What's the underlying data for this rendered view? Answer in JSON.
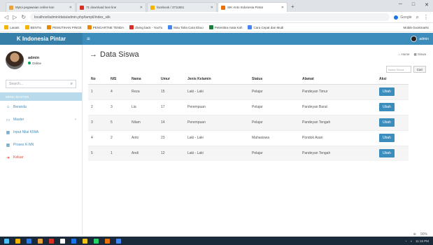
{
  "browser": {
    "tabs": [
      {
        "title": "Mytoi pegawaian online kan",
        "color": "#e8a33a",
        "active": false
      },
      {
        "title": "71 download love line",
        "color": "#d93025",
        "active": false
      },
      {
        "title": "facebook / 3711651",
        "color": "#f4b400",
        "active": false
      },
      {
        "title": "SIK Anto Indonesia Pintar",
        "color": "#e8710a",
        "active": true
      }
    ],
    "url": "localhost/admin/data/admin.php/tampil/index_siik",
    "search_engine": "Google",
    "bookmarks": [
      {
        "label": "Lanats",
        "color": "#f4b400"
      },
      {
        "label": "BENTIx",
        "color": "#f4b400"
      },
      {
        "label": "PEMUTIHAN PINGE",
        "color": "#ea8600"
      },
      {
        "label": "PENGARTNE TENDA",
        "color": "#ea8600"
      },
      {
        "label": "diving back - YouTu",
        "color": "#d93025"
      },
      {
        "label": "Mau Talra Cara Ebuo",
        "color": "#4285f4"
      },
      {
        "label": "Petentitra mata Kah",
        "color": "#188038"
      },
      {
        "label": "Cara Cepat dan Mudi",
        "color": "#4285f4"
      }
    ],
    "bookmarks_right": "Mobile bookmarks"
  },
  "header": {
    "brand": "K Indonesia Pintar",
    "user": "admin"
  },
  "sidebar": {
    "user_name": "admin",
    "user_status": "Online",
    "search_placeholder": "Search...",
    "menu_header": "MENU MASTER",
    "items": [
      {
        "label": "Beranda",
        "icon": "home-icon",
        "glyph": "⌂",
        "red": false,
        "chevron": false
      },
      {
        "label": "Master",
        "icon": "laptop-icon",
        "glyph": "▭",
        "red": false,
        "chevron": true
      },
      {
        "label": "Input Nilai KIWA",
        "icon": "table-icon",
        "glyph": "▦",
        "red": false,
        "chevron": false
      },
      {
        "label": "Proses K-NN",
        "icon": "table-icon",
        "glyph": "▦",
        "red": false,
        "chevron": false
      },
      {
        "label": "Keluar",
        "icon": "signout-icon",
        "glyph": "➜",
        "red": true,
        "chevron": false
      }
    ]
  },
  "content": {
    "title": "Data Siswa",
    "breadcrumb_home": "Home",
    "breadcrumb_current": "Siswa",
    "filter_placeholder": "Nama Siswa",
    "filter_button": "Cari",
    "columns": [
      "No",
      "NIS",
      "Nama",
      "Umur",
      "Jenis Kelamin",
      "Status",
      "Alamat",
      "Aksi"
    ],
    "rows": [
      [
        "1",
        "4",
        "Reza",
        "15",
        "Laki - Laki",
        "Pelajar",
        "Pandeyan Timur",
        "Ubah"
      ],
      [
        "2",
        "3",
        "Lia",
        "17",
        "Perempuan",
        "Pelajar",
        "Pandeyan Barat",
        "Ubah"
      ],
      [
        "3",
        "5",
        "Nilam",
        "14",
        "Perempuan",
        "Pelajar",
        "Pandeyan Tengah",
        "Ubah"
      ],
      [
        "4",
        "2",
        "Anto",
        "23",
        "Laki - Laki",
        "Mahasiswa",
        "Pondok Asari",
        "Ubah"
      ],
      [
        "5",
        "1",
        "Andi",
        "12",
        "Laki - Laki",
        "Pelajar",
        "Pandeyan Tengah",
        "Ubah"
      ]
    ]
  },
  "status": {
    "zoom": "90%"
  },
  "taskbar": {
    "clock": "11:15 PM",
    "apps": [
      "#4cc2ff",
      "#f4b400",
      "#2d7be5",
      "#e8a33a",
      "#d93025",
      "#ffffff",
      "#1a73e8",
      "#f0c419",
      "#25d366",
      "#e8710a",
      "#4285f4"
    ]
  }
}
